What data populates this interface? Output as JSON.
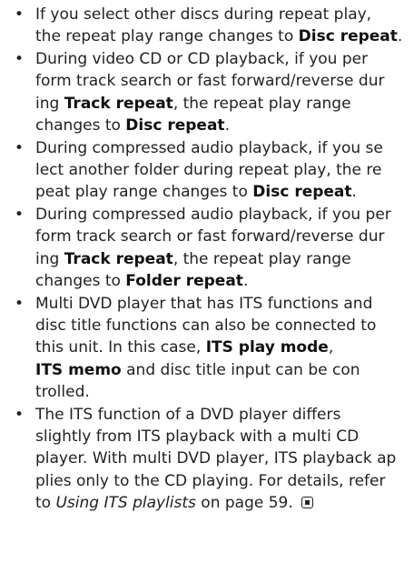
{
  "bullets": [
    {
      "lines": [
        [
          "If you select other discs during repeat play,"
        ],
        [
          "the repeat play range changes to ",
          {
            "b": "Disc repeat"
          },
          "."
        ]
      ]
    },
    {
      "lines": [
        [
          "During video CD or CD playback, if you per"
        ],
        [
          "form track search or fast forward/reverse dur"
        ],
        [
          "ing ",
          {
            "b": "Track repeat"
          },
          ", the repeat play range"
        ],
        [
          "changes to ",
          {
            "b": "Disc repeat"
          },
          "."
        ]
      ]
    },
    {
      "lines": [
        [
          "During compressed audio playback, if you se"
        ],
        [
          "lect another folder during repeat play, the re"
        ],
        [
          "peat play range changes to ",
          {
            "b": "Disc repeat"
          },
          "."
        ]
      ]
    },
    {
      "lines": [
        [
          "During compressed audio playback, if you per"
        ],
        [
          "form track search or fast forward/reverse dur"
        ],
        [
          "ing ",
          {
            "b": "Track repeat"
          },
          ", the repeat play range"
        ],
        [
          "changes to ",
          {
            "b": "Folder repeat"
          },
          "."
        ]
      ]
    },
    {
      "lines": [
        [
          "Multi DVD player that has ITS functions and"
        ],
        [
          "disc title functions can also be connected to"
        ],
        [
          "this unit. In this case, ",
          {
            "b": "ITS play mode"
          },
          ","
        ],
        [
          {
            "b": "ITS memo"
          },
          " and disc title input can be con"
        ],
        [
          "trolled."
        ]
      ]
    },
    {
      "lines": [
        [
          "The ITS function of a DVD player differs"
        ],
        [
          "slightly from ITS playback with a multi CD"
        ],
        [
          "player. With multi DVD player, ITS playback ap"
        ],
        [
          "plies only to the CD playing. For details, refer"
        ],
        [
          "to ",
          {
            "i": "Using ITS playlists"
          },
          " on page 59. ",
          {
            "end_mark": "end-of-section-icon"
          }
        ]
      ]
    }
  ]
}
